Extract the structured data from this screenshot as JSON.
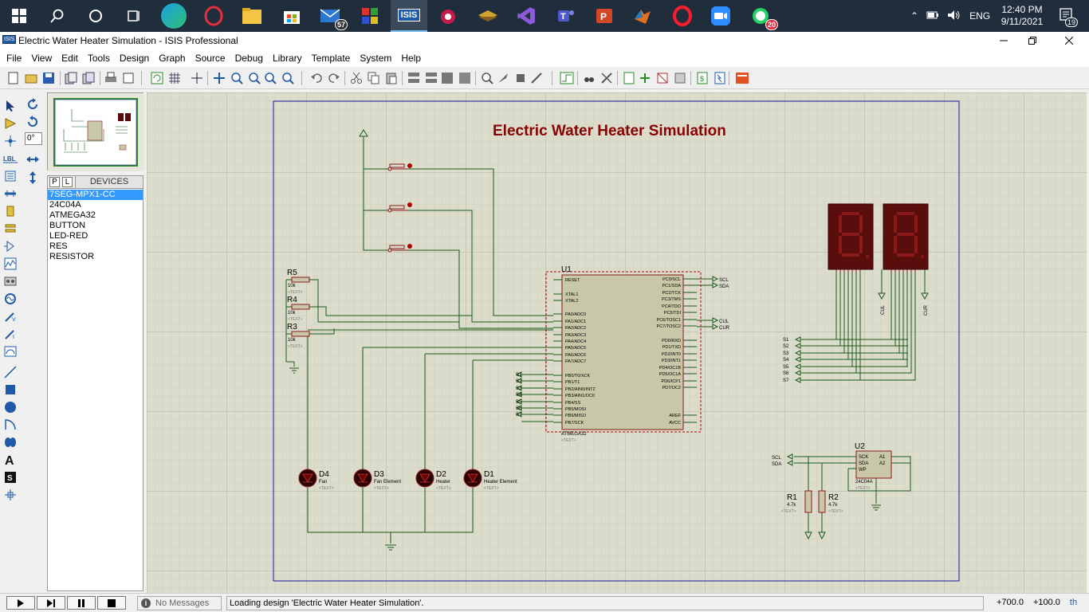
{
  "taskbar": {
    "apps": [
      {
        "name": "mail",
        "badge": "57"
      },
      {
        "name": "isis",
        "label": "ISIS"
      },
      {
        "name": "whatsapp",
        "badge": "20"
      }
    ],
    "language": "ENG",
    "time": "12:40 PM",
    "date": "9/11/2021",
    "notification_count": "19"
  },
  "window": {
    "title": "Electric Water Heater Simulation - ISIS Professional",
    "app_icon_text": "ISIS"
  },
  "menu": [
    "File",
    "View",
    "Edit",
    "Tools",
    "Design",
    "Graph",
    "Source",
    "Debug",
    "Library",
    "Template",
    "System",
    "Help"
  ],
  "sidepanel": {
    "rotation_value": "0°",
    "tab_p": "P",
    "tab_l": "L",
    "devices_header": "DEVICES",
    "devices": [
      "7SEG-MPX1-CC",
      "24C04A",
      "ATMEGA32",
      "BUTTON",
      "LED-RED",
      "RES",
      "RESISTOR"
    ],
    "selected_index": 0
  },
  "schematic": {
    "title": "Electric Water Heater Simulation",
    "u1_ref": "U1",
    "u1_part": "ATMEGA32",
    "u1_left_pins": [
      "RESET",
      "XTAL1",
      "XTAL2",
      "PA0/ADC0",
      "PA1/ADC1",
      "PA2/ADC2",
      "PA3/ADC3",
      "PA4/ADC4",
      "PA5/ADC5",
      "PA6/ADC6",
      "PA7/ADC7",
      "PB0/T0/XCK",
      "PB1/T1",
      "PB2/AIN0/INT2",
      "PB3/AIN1/OC0",
      "PB4/SS",
      "PB5/MOSI",
      "PB6/MISO",
      "PB7/SCK"
    ],
    "u1_right_pins": [
      "PC0/SCL",
      "PC1/SDA",
      "PC2/TCK",
      "PC3/TMS",
      "PC4/TDO",
      "PC5/TDI",
      "PC6/TOSC1",
      "PC7/TOSC2",
      "PD0/RXD",
      "PD1/TXD",
      "PD2/INT0",
      "PD3/INT1",
      "PD4/OC1B",
      "PD5/OC1A",
      "PD6/ICP1",
      "PD7/OC2",
      "AREF",
      "AVCC"
    ],
    "resistors": [
      {
        "ref": "R5",
        "value": "10k"
      },
      {
        "ref": "R4",
        "value": "10k"
      },
      {
        "ref": "R3",
        "value": "10k"
      }
    ],
    "leds": [
      {
        "ref": "D4",
        "label": "Fan"
      },
      {
        "ref": "D3",
        "label": "Fan Element"
      },
      {
        "ref": "D2",
        "label": "Heater"
      },
      {
        "ref": "D1",
        "label": "Heater Element"
      }
    ],
    "text_placeholder": "<TEXT>",
    "bus_labels": [
      "S1",
      "S2",
      "S3",
      "S4",
      "S5",
      "S6",
      "S7"
    ],
    "scl": "SCL",
    "sda": "SDA",
    "cul": "CUL",
    "cur": "CUR",
    "u2_ref": "U2",
    "u2_part": "24C04A",
    "u2_pins": [
      "SCK",
      "SDA",
      "WP",
      "A1",
      "A2"
    ],
    "pull_ups": [
      {
        "ref": "R1",
        "value": "4.7k"
      },
      {
        "ref": "R2",
        "value": "4.7k"
      }
    ]
  },
  "status": {
    "messages": "No Messages",
    "text": "Loading design 'Electric Water Heater Simulation'.",
    "coord_x": "+700.0",
    "coord_y": "+100.0",
    "unit": "th"
  },
  "colors": {
    "taskbar": "#1f2d3d",
    "sheet_bg": "#dcdccc",
    "wire": "#1a5a1a",
    "component": "#8b1a1a",
    "ic_body": "#c8c8a8",
    "title": "#8b0000",
    "seven_seg": "#5a0d0d",
    "selection": "#3399ff"
  }
}
